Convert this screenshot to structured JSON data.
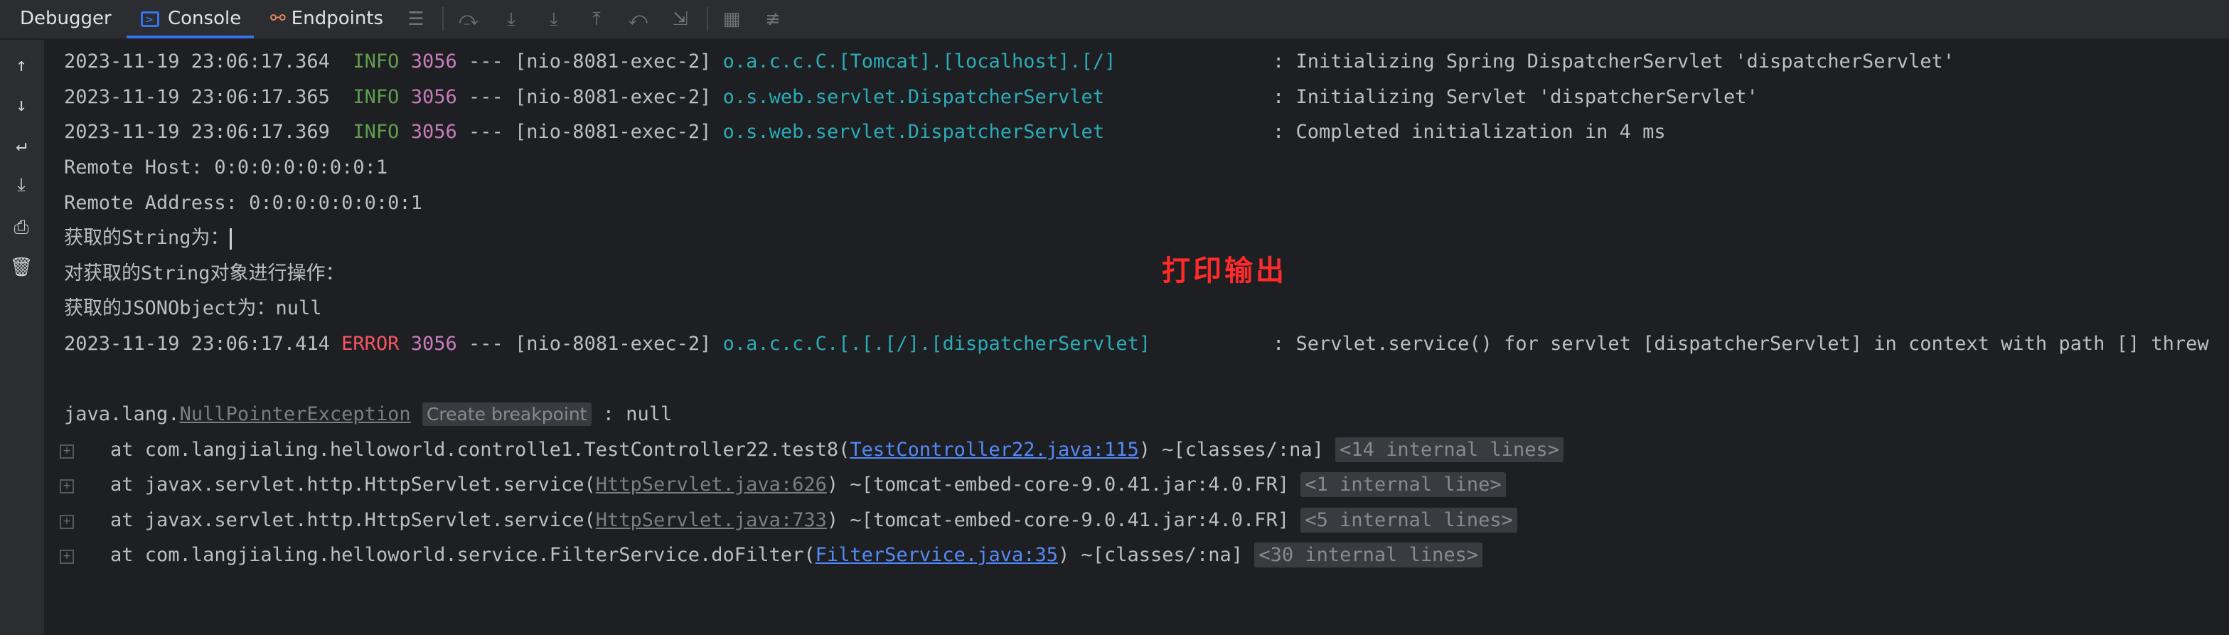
{
  "tabs": {
    "debugger": "Debugger",
    "console": "Console",
    "endpoints": "Endpoints"
  },
  "toolbar_icons": [
    "menu-icon",
    "step-over-icon",
    "step-into-icon",
    "force-step-into-icon",
    "step-out-icon",
    "drop-frame-icon",
    "run-to-cursor-icon",
    "evaluate-icon",
    "trace-icon"
  ],
  "colors": {
    "info": "#5f9d4f",
    "error": "#f75464",
    "pid": "#c77dbb",
    "logger": "#2aacb8",
    "link": "#548af7",
    "annotation": "#ff2a2a"
  },
  "log": {
    "l1": {
      "ts": "2023-11-19 23:06:17.364",
      "level": "INFO",
      "pid": "3056",
      "sep": "---",
      "thread": "[nio-8081-exec-2]",
      "logger": "o.a.c.c.C.[Tomcat].[localhost].[/]",
      "msg": ": Initializing Spring DispatcherServlet 'dispatcherServlet'"
    },
    "l2": {
      "ts": "2023-11-19 23:06:17.365",
      "level": "INFO",
      "pid": "3056",
      "sep": "---",
      "thread": "[nio-8081-exec-2]",
      "logger": "o.s.web.servlet.DispatcherServlet",
      "msg": ": Initializing Servlet 'dispatcherServlet'"
    },
    "l3": {
      "ts": "2023-11-19 23:06:17.369",
      "level": "INFO",
      "pid": "3056",
      "sep": "---",
      "thread": "[nio-8081-exec-2]",
      "logger": "o.s.web.servlet.DispatcherServlet",
      "msg": ": Completed initialization in 4 ms"
    },
    "remote_host": "Remote Host: 0:0:0:0:0:0:0:1",
    "remote_address": "Remote Address: 0:0:0:0:0:0:0:1",
    "string_label": "获取的String为：",
    "string_op": "对获取的String对象进行操作：",
    "json_label": "获取的JSONObject为：null",
    "l4": {
      "ts": "2023-11-19 23:06:17.414",
      "level": "ERROR",
      "pid": "3056",
      "sep": "---",
      "thread": "[nio-8081-exec-2]",
      "logger": "o.a.c.c.C.[.[.[/].[dispatcherServlet]",
      "msg": ": Servlet.service() for servlet [dispatcherServlet] in context with path [] threw"
    },
    "exception": {
      "prefix": "java.lang.",
      "name": "NullPointerException",
      "breakpoint": "Create breakpoint",
      "suffix": " : null"
    },
    "frames": [
      {
        "text": "    at com.langjialing.helloworld.controlle1.TestController22.test8(",
        "link": "TestController22.java:115",
        "rest": ") ~[classes/:na] ",
        "internal": "<14 internal lines>"
      },
      {
        "text": "    at javax.servlet.http.HttpServlet.service(",
        "link": "HttpServlet.java:626",
        "rest": ") ~[tomcat-embed-core-9.0.41.jar:4.0.FR] ",
        "internal": "<1 internal line>"
      },
      {
        "text": "    at javax.servlet.http.HttpServlet.service(",
        "link": "HttpServlet.java:733",
        "rest": ") ~[tomcat-embed-core-9.0.41.jar:4.0.FR] ",
        "internal": "<5 internal lines>"
      },
      {
        "text": "    at com.langjialing.helloworld.service.FilterService.doFilter(",
        "link": "FilterService.java:35",
        "rest": ") ~[classes/:na] ",
        "internal": "<30 internal lines>"
      }
    ]
  },
  "annotation": "打印输出"
}
